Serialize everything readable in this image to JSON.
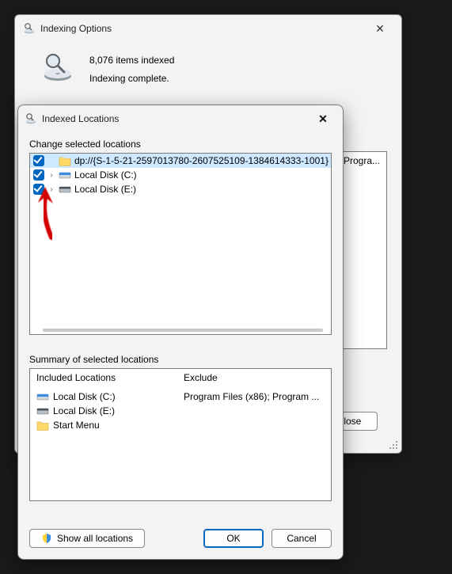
{
  "indexing_options": {
    "title": "Indexing Options",
    "items_indexed": "8,076 items indexed",
    "status": "Indexing complete.",
    "visible_row_text": "iles; Progra...",
    "close_btn": "Close"
  },
  "indexed_locations": {
    "title": "Indexed Locations",
    "section_change": "Change selected locations",
    "section_summary": "Summary of selected locations",
    "tree": [
      {
        "label": "dp://{S-1-5-21-2597013780-2607525109-1384614333-1001}",
        "checked": true,
        "expandable": false,
        "icon": "folder",
        "highlight": true
      },
      {
        "label": "Local Disk (C:)",
        "checked": true,
        "expandable": true,
        "icon": "disk-blue",
        "highlight": false
      },
      {
        "label": "Local Disk (E:)",
        "checked": true,
        "expandable": true,
        "icon": "disk-gray",
        "highlight": false
      }
    ],
    "summary_headers": {
      "included": "Included Locations",
      "exclude": "Exclude"
    },
    "summary_included": [
      {
        "icon": "disk-blue",
        "label": "Local Disk (C:)"
      },
      {
        "icon": "disk-gray",
        "label": "Local Disk (E:)"
      },
      {
        "icon": "folder",
        "label": "Start Menu"
      }
    ],
    "summary_exclude": "Program Files (x86); Program ...",
    "buttons": {
      "show_all": "Show all locations",
      "ok": "OK",
      "cancel": "Cancel"
    }
  }
}
